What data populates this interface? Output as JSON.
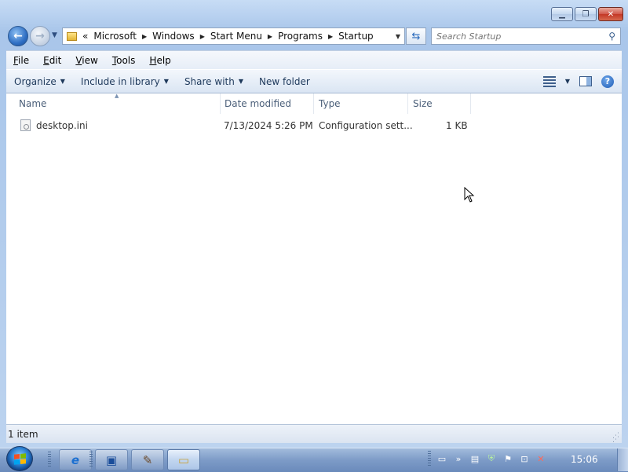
{
  "window": {
    "caption_buttons": {
      "minimize": "▁",
      "maximize": "❐",
      "close": "✕"
    }
  },
  "address": {
    "overflow": "«",
    "crumbs": [
      "Microsoft",
      "Windows",
      "Start Menu",
      "Programs",
      "Startup"
    ],
    "separator": "▶",
    "dropdown": "▼"
  },
  "search": {
    "placeholder": "Search Startup",
    "icon": "search-icon"
  },
  "menu": {
    "items": [
      {
        "u": "F",
        "rest": "ile"
      },
      {
        "u": "E",
        "rest": "dit"
      },
      {
        "u": "V",
        "rest": "iew"
      },
      {
        "u": "T",
        "rest": "ools"
      },
      {
        "u": "H",
        "rest": "elp"
      }
    ]
  },
  "toolbar": {
    "organize": "Organize",
    "include_in_library": "Include in library",
    "share_with": "Share with",
    "new_folder": "New folder",
    "dropdown": "▼",
    "help": "?"
  },
  "columns": {
    "name": "Name",
    "date_modified": "Date modified",
    "type": "Type",
    "size": "Size",
    "sort_indicator": "▲"
  },
  "files": [
    {
      "name": "desktop.ini",
      "date_modified": "7/13/2024 5:26 PM",
      "type": "Configuration sett...",
      "size": "1 KB",
      "icon": "settings-file-icon"
    }
  ],
  "status": {
    "item_count": "1 item"
  },
  "taskbar": {
    "clock": "15:06",
    "pinned": [
      {
        "icon": "internet-explorer-icon",
        "glyph": "e"
      },
      {
        "icon": "remote-desktop-icon",
        "glyph": "▣"
      },
      {
        "icon": "gimp-icon",
        "glyph": "✎"
      },
      {
        "icon": "windows-explorer-icon",
        "glyph": "▭"
      }
    ]
  }
}
